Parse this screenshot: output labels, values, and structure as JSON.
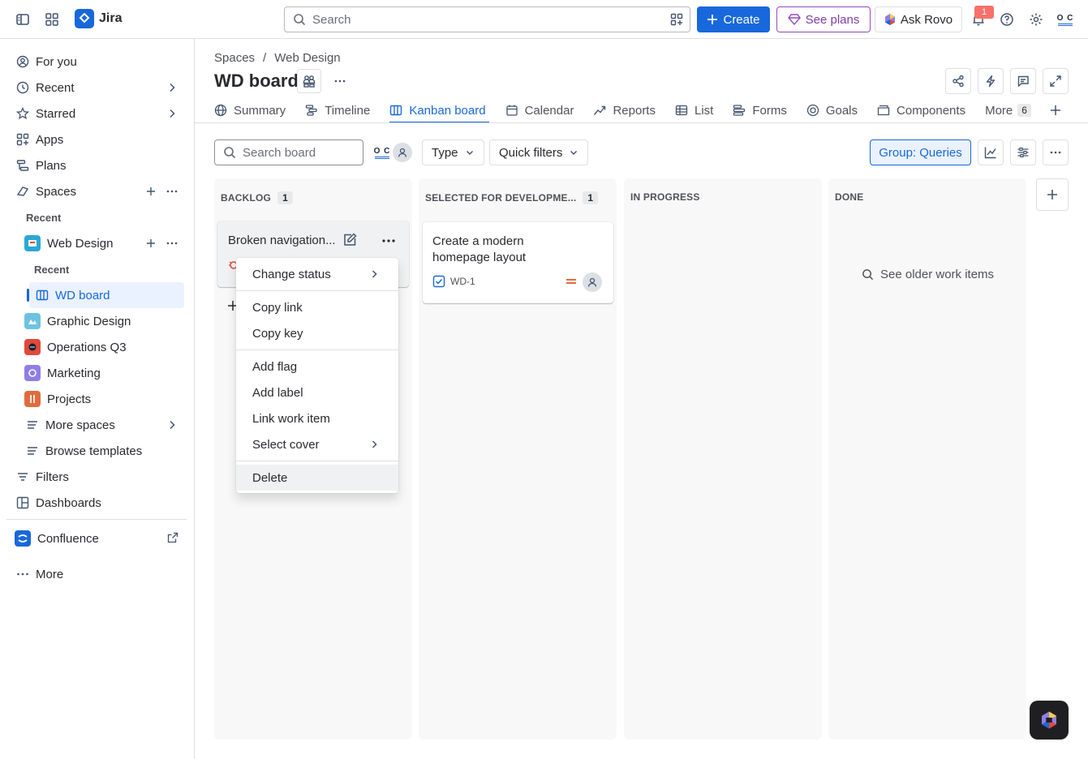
{
  "topbar": {
    "app_name": "Jira",
    "search_placeholder": "Search",
    "create_label": "Create",
    "plans_label": "See plans",
    "rovo_label": "Ask Rovo",
    "notification_count": "1",
    "avatar_initials": "O C"
  },
  "sidebar": {
    "items": [
      {
        "label": "For you"
      },
      {
        "label": "Recent"
      },
      {
        "label": "Starred"
      },
      {
        "label": "Apps"
      },
      {
        "label": "Plans"
      },
      {
        "label": "Spaces"
      }
    ],
    "spaces_recent_label": "Recent",
    "web_design_label": "Web Design",
    "web_design_recent_label": "Recent",
    "wd_board_label": "WD board",
    "projects": [
      {
        "label": "Graphic Design",
        "color": "#6cc3e0"
      },
      {
        "label": "Operations Q3",
        "color": "#e2483d"
      },
      {
        "label": "Marketing",
        "color": "#8f7ee7"
      },
      {
        "label": "Projects",
        "color": "#e06c3d"
      }
    ],
    "more_spaces_label": "More spaces",
    "browse_templates_label": "Browse templates",
    "filters_label": "Filters",
    "dashboards_label": "Dashboards",
    "confluence_label": "Confluence",
    "more_label": "More"
  },
  "header": {
    "breadcrumb_spaces": "Spaces",
    "breadcrumb_sep": "/",
    "breadcrumb_project": "Web Design",
    "title": "WD board"
  },
  "tabs": [
    {
      "label": "Summary",
      "icon": "globe-icon"
    },
    {
      "label": "Timeline",
      "icon": "timeline-icon"
    },
    {
      "label": "Kanban board",
      "icon": "board-icon",
      "active": true
    },
    {
      "label": "Calendar",
      "icon": "calendar-icon"
    },
    {
      "label": "Reports",
      "icon": "chart-icon"
    },
    {
      "label": "List",
      "icon": "list-icon"
    },
    {
      "label": "Forms",
      "icon": "forms-icon"
    },
    {
      "label": "Goals",
      "icon": "target-icon"
    },
    {
      "label": "Components",
      "icon": "component-icon"
    }
  ],
  "more_tab": {
    "label": "More",
    "count": "6"
  },
  "toolbar": {
    "search_placeholder": "Search board",
    "type_label": "Type",
    "quick_filters_label": "Quick filters",
    "group_label": "Group: Queries"
  },
  "columns": [
    {
      "title": "BACKLOG",
      "count": "1"
    },
    {
      "title": "SELECTED FOR DEVELOPME...",
      "count": "1"
    },
    {
      "title": "IN PROGRESS",
      "count": ""
    },
    {
      "title": "DONE",
      "count": ""
    }
  ],
  "cards": {
    "backlog_title": "Broken navigation...",
    "wd1_title": "Create a modern homepage layout",
    "wd1_key": "WD-1"
  },
  "done_see_older": "See older work items",
  "context_menu": {
    "change_status": "Change status",
    "copy_link": "Copy link",
    "copy_key": "Copy key",
    "add_flag": "Add flag",
    "add_label": "Add label",
    "link_work_item": "Link work item",
    "select_cover": "Select cover",
    "delete": "Delete"
  },
  "colors": {
    "accent": "#1868db",
    "plans": "#964ac0"
  }
}
